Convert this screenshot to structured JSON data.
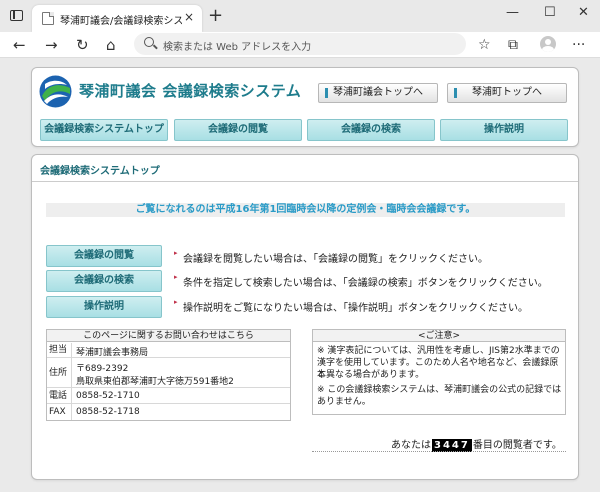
{
  "browser": {
    "tab_title": "琴浦町議会/会議録検索システム",
    "tab_close": "×",
    "new_tab": "+",
    "window_controls": {
      "minimize": "—",
      "maximize": "☐",
      "close": "✕"
    },
    "nav": {
      "back": "←",
      "forward": "→",
      "reload": "↻",
      "home": "⌂"
    },
    "address_placeholder": "検索または Web アドレスを入力",
    "tools": {
      "favorite": "☆",
      "collections": "⧉",
      "menu": "···"
    }
  },
  "header": {
    "site_title": "琴浦町議会 会議録検索システム",
    "top_links": [
      "琴浦町議会トップへ",
      "琴浦町トップへ"
    ],
    "nav_tabs": [
      "会議録検索システムトップ",
      "会議録の閲覧",
      "会議録の検索",
      "操作説明"
    ]
  },
  "main": {
    "section_title": "会議録検索システムトップ",
    "notice": "ご覧になれるのは平成16年第1回臨時会以降の定例会・臨時会会議録です。",
    "bullet_glyph": "▸",
    "menu": [
      {
        "label": "会議録の閲覧",
        "description": "会議録を閲覧したい場合は、「会議録の閲覧」をクリックください。"
      },
      {
        "label": "会議録の検索",
        "description": "条件を指定して検索したい場合は、「会議録の検索」ボタンをクリックください。"
      },
      {
        "label": "操作説明",
        "description": "操作説明をご覧になりたい場合は、「操作説明」ボタンをクリックください。"
      }
    ],
    "contact": {
      "heading": "このページに関するお問い合わせはこちら",
      "rows": [
        {
          "label": "担当",
          "values": [
            "琴浦町議会事務局"
          ]
        },
        {
          "label": "住所",
          "values": [
            "〒689-2392",
            "鳥取県東伯郡琴浦町大字徳万591番地2"
          ]
        },
        {
          "label": "電話",
          "values": [
            "0858-52-1710"
          ]
        },
        {
          "label": "FAX",
          "values": [
            "0858-52-1718"
          ]
        }
      ]
    },
    "caution": {
      "heading": "<ご注意>",
      "lines": [
        "※ 漢字表記については、汎用性を考慮し、JIS第2水準までの",
        "漢字を使用しています。このため人名や地名など、会議録原本",
        "と異なる場合があります。",
        "※ この会議録検索システムは、琴浦町議会の公式の記録では",
        "ありません。"
      ]
    },
    "counter": {
      "prefix": "あなたは",
      "digits": "3447",
      "suffix": "番目の閲覧者です。"
    }
  },
  "colors": {
    "title_teal": "#1e7c8c",
    "nav_button_bg": "#b8e6ea",
    "notice_blue": "#2a9bc7",
    "bullet_red": "#c0304a",
    "logo_blue": "#1c63b0",
    "logo_green": "#3fb24a"
  }
}
